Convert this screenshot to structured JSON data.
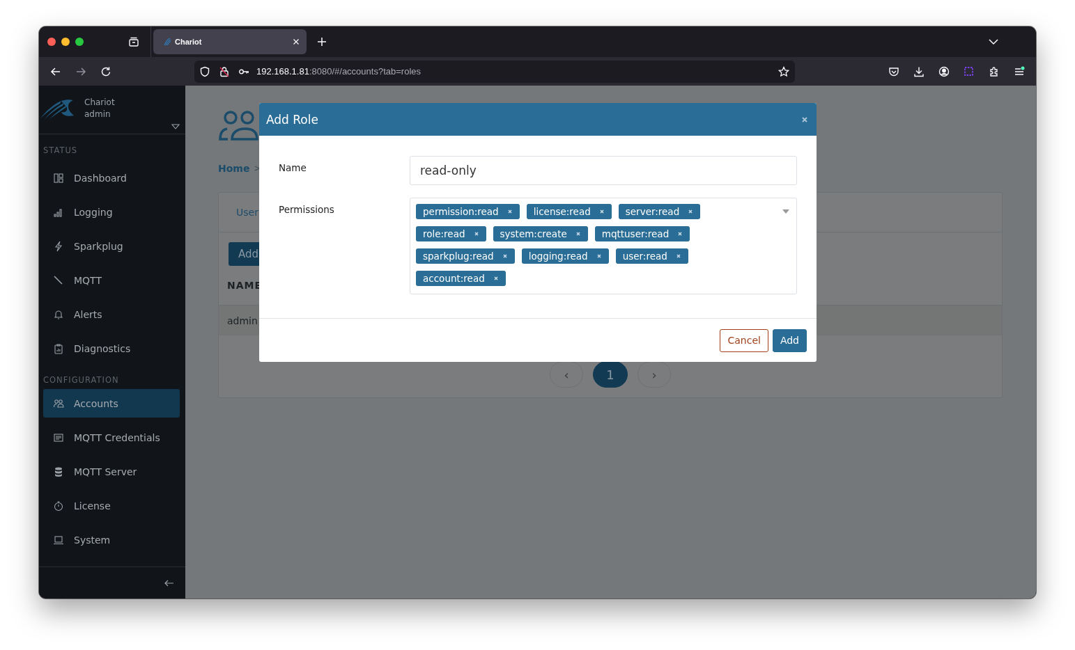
{
  "browser": {
    "tab_title": "Chariot",
    "url_host": "192.168.1.81",
    "url_rest": ":8080/#/accounts?tab=roles"
  },
  "sidebar": {
    "app_name": "Chariot",
    "user": "admin",
    "sections": [
      {
        "title": "STATUS",
        "items": [
          {
            "label": "Dashboard",
            "kind": "dashboard",
            "selected": false
          },
          {
            "label": "Logging",
            "kind": "bars",
            "selected": false
          },
          {
            "label": "Sparkplug",
            "kind": "bolt",
            "selected": false
          },
          {
            "label": "MQTT",
            "kind": "probe",
            "selected": false
          },
          {
            "label": "Alerts",
            "kind": "bell",
            "selected": false
          },
          {
            "label": "Diagnostics",
            "kind": "clipboard",
            "selected": false
          }
        ]
      },
      {
        "title": "CONFIGURATION",
        "items": [
          {
            "label": "Accounts",
            "kind": "users",
            "selected": true
          },
          {
            "label": "MQTT Credentials",
            "kind": "card",
            "selected": false
          },
          {
            "label": "MQTT Server",
            "kind": "database",
            "selected": false
          },
          {
            "label": "License",
            "kind": "stopwatch",
            "selected": false
          },
          {
            "label": "System",
            "kind": "laptop",
            "selected": false
          }
        ]
      }
    ]
  },
  "page": {
    "breadcrumb": [
      "Home",
      ">"
    ],
    "tabs": [
      "User"
    ],
    "add_button": "Add",
    "table": {
      "columns": [
        "NAME"
      ],
      "rows": [
        [
          "admin"
        ]
      ]
    },
    "pagination": {
      "prev": "‹",
      "pages": [
        {
          "label": "1",
          "selected": true
        }
      ],
      "next": "›"
    }
  },
  "dialog": {
    "title": "Add Role",
    "fields": [
      {
        "kind": "text",
        "label": "Name",
        "value": "read-only"
      },
      {
        "kind": "tags",
        "label": "Permissions",
        "tags": [
          "permission:read",
          "license:read",
          "server:read",
          "role:read",
          "system:create",
          "mqttuser:read",
          "sparkplug:read",
          "logging:read",
          "user:read",
          "account:read"
        ]
      }
    ],
    "buttons": [
      {
        "label": "Cancel",
        "kind": "secondary"
      },
      {
        "label": "Add",
        "kind": "primary"
      }
    ]
  }
}
